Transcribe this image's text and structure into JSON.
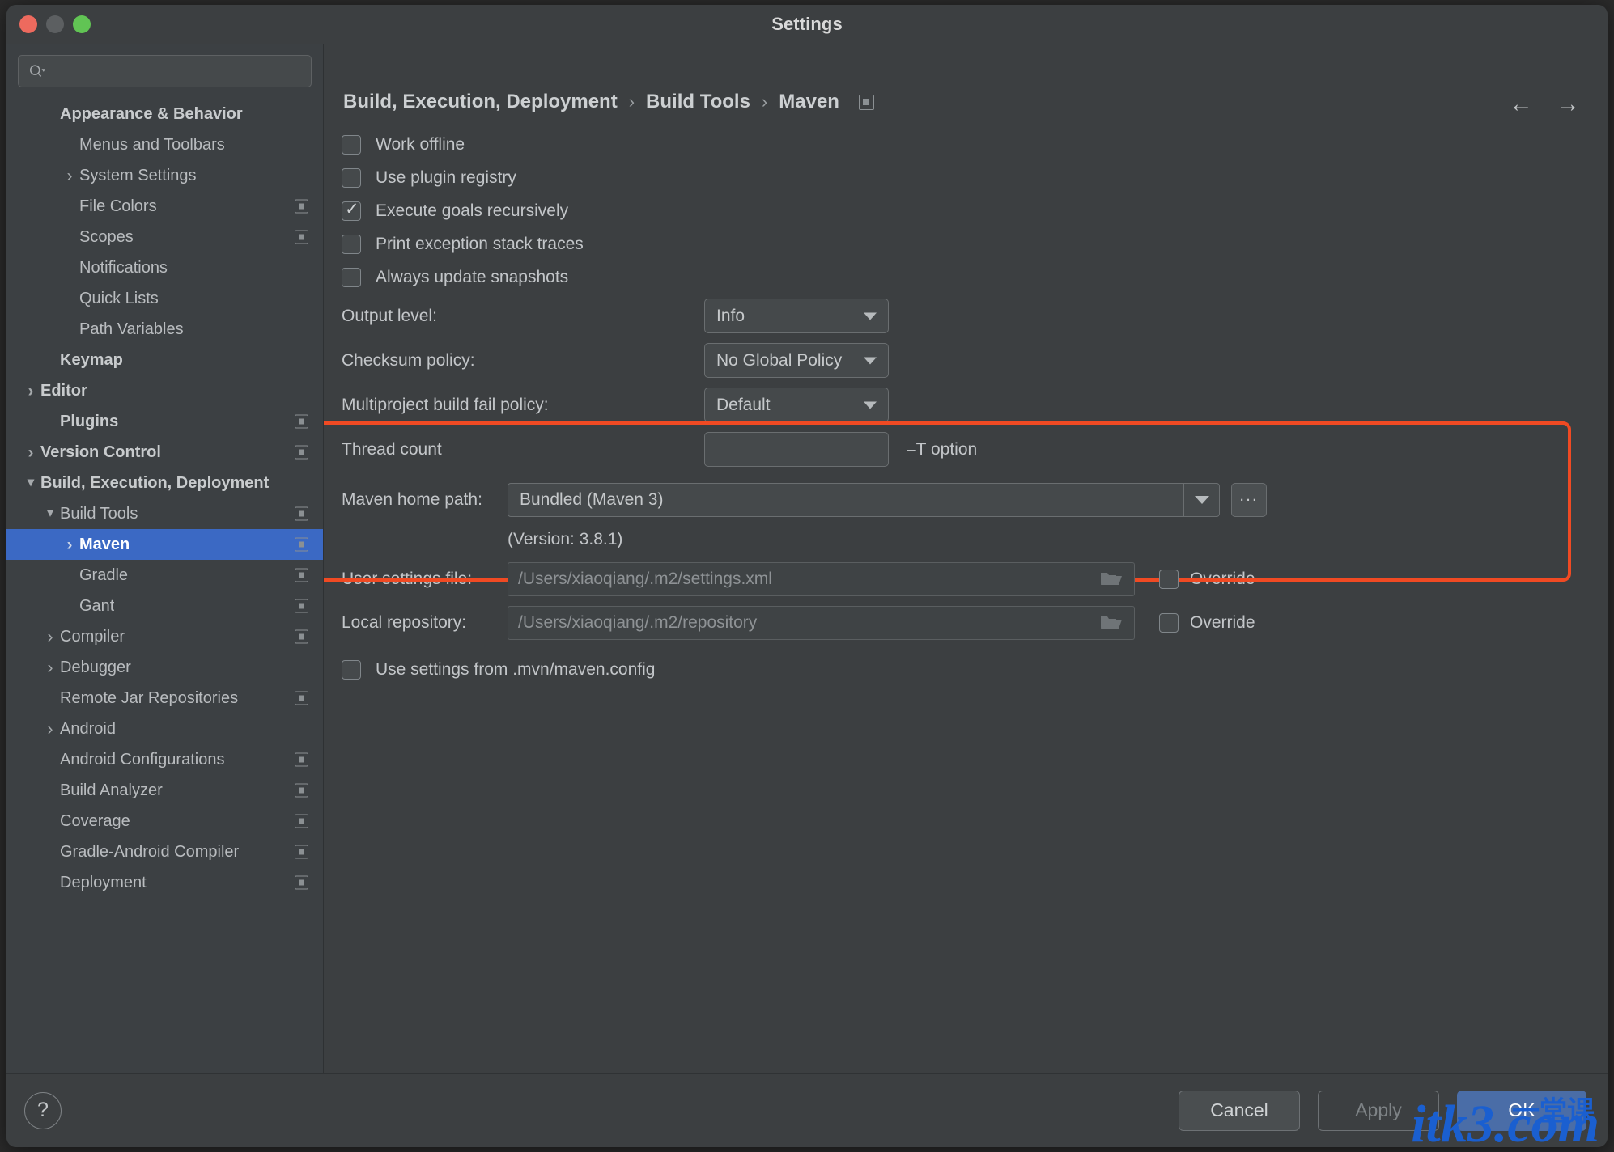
{
  "window": {
    "title": "Settings"
  },
  "search": {
    "placeholder": ""
  },
  "sidebar": {
    "items": [
      {
        "label": "Appearance & Behavior",
        "arrow": "none",
        "indent": 1,
        "bold": true,
        "badge": false,
        "selected": false
      },
      {
        "label": "Menus and Toolbars",
        "arrow": "none",
        "indent": 2,
        "bold": false,
        "badge": false,
        "selected": false
      },
      {
        "label": "System Settings",
        "arrow": "right",
        "indent": 2,
        "bold": false,
        "badge": false,
        "selected": false
      },
      {
        "label": "File Colors",
        "arrow": "none",
        "indent": 2,
        "bold": false,
        "badge": true,
        "selected": false
      },
      {
        "label": "Scopes",
        "arrow": "none",
        "indent": 2,
        "bold": false,
        "badge": true,
        "selected": false
      },
      {
        "label": "Notifications",
        "arrow": "none",
        "indent": 2,
        "bold": false,
        "badge": false,
        "selected": false
      },
      {
        "label": "Quick Lists",
        "arrow": "none",
        "indent": 2,
        "bold": false,
        "badge": false,
        "selected": false
      },
      {
        "label": "Path Variables",
        "arrow": "none",
        "indent": 2,
        "bold": false,
        "badge": false,
        "selected": false
      },
      {
        "label": "Keymap",
        "arrow": "none",
        "indent": 1,
        "bold": true,
        "badge": false,
        "selected": false
      },
      {
        "label": "Editor",
        "arrow": "right",
        "indent": 0,
        "bold": true,
        "badge": false,
        "selected": false
      },
      {
        "label": "Plugins",
        "arrow": "none",
        "indent": 1,
        "bold": true,
        "badge": true,
        "selected": false
      },
      {
        "label": "Version Control",
        "arrow": "right",
        "indent": 0,
        "bold": true,
        "badge": true,
        "selected": false
      },
      {
        "label": "Build, Execution, Deployment",
        "arrow": "down",
        "indent": 0,
        "bold": true,
        "badge": false,
        "selected": false
      },
      {
        "label": "Build Tools",
        "arrow": "down",
        "indent": 1,
        "bold": false,
        "badge": true,
        "selected": false
      },
      {
        "label": "Maven",
        "arrow": "right",
        "indent": 2,
        "bold": true,
        "badge": true,
        "selected": true
      },
      {
        "label": "Gradle",
        "arrow": "none",
        "indent": 2,
        "bold": false,
        "badge": true,
        "selected": false
      },
      {
        "label": "Gant",
        "arrow": "none",
        "indent": 2,
        "bold": false,
        "badge": true,
        "selected": false
      },
      {
        "label": "Compiler",
        "arrow": "right",
        "indent": 1,
        "bold": false,
        "badge": true,
        "selected": false
      },
      {
        "label": "Debugger",
        "arrow": "right",
        "indent": 1,
        "bold": false,
        "badge": false,
        "selected": false
      },
      {
        "label": "Remote Jar Repositories",
        "arrow": "none",
        "indent": 1,
        "bold": false,
        "badge": true,
        "selected": false
      },
      {
        "label": "Android",
        "arrow": "right",
        "indent": 1,
        "bold": false,
        "badge": false,
        "selected": false
      },
      {
        "label": "Android Configurations",
        "arrow": "none",
        "indent": 1,
        "bold": false,
        "badge": true,
        "selected": false
      },
      {
        "label": "Build Analyzer",
        "arrow": "none",
        "indent": 1,
        "bold": false,
        "badge": true,
        "selected": false
      },
      {
        "label": "Coverage",
        "arrow": "none",
        "indent": 1,
        "bold": false,
        "badge": true,
        "selected": false
      },
      {
        "label": "Gradle-Android Compiler",
        "arrow": "none",
        "indent": 1,
        "bold": false,
        "badge": true,
        "selected": false
      },
      {
        "label": "Deployment",
        "arrow": "none",
        "indent": 1,
        "bold": false,
        "badge": true,
        "selected": false
      }
    ]
  },
  "breadcrumb": {
    "part1": "Build, Execution, Deployment",
    "sep1": "›",
    "part2": "Build Tools",
    "sep2": "›",
    "part3": "Maven",
    "back_icon": "←",
    "forward_icon": "→"
  },
  "main": {
    "checkboxes": [
      {
        "label": "Work offline",
        "checked": false
      },
      {
        "label": "Use plugin registry",
        "checked": false
      },
      {
        "label": "Execute goals recursively",
        "checked": true
      },
      {
        "label": "Print exception stack traces",
        "checked": false
      },
      {
        "label": "Always update snapshots",
        "checked": false
      }
    ],
    "selects": [
      {
        "label": "Output level:",
        "value": "Info"
      },
      {
        "label": "Checksum policy:",
        "value": "No Global Policy"
      },
      {
        "label": "Multiproject build fail policy:",
        "value": "Default"
      }
    ],
    "thread_count": {
      "label": "Thread count",
      "value": "",
      "hint": "–T option"
    },
    "maven_home": {
      "label": "Maven home path:",
      "value": "Bundled (Maven 3)",
      "browse_label": "...",
      "version_text": "(Version: 3.8.1)"
    },
    "user_settings": {
      "label": "User settings file:",
      "value": "/Users/xiaoqiang/.m2/settings.xml",
      "override_label": "Override",
      "override_checked": false
    },
    "local_repository": {
      "label": "Local repository:",
      "value": "/Users/xiaoqiang/.m2/repository",
      "override_label": "Override",
      "override_checked": false
    },
    "mvn_config": {
      "label": "Use settings from .mvn/maven.config",
      "checked": false
    }
  },
  "footer": {
    "help_label": "?",
    "cancel_label": "Cancel",
    "apply_label": "Apply",
    "ok_label": "OK"
  },
  "watermark": {
    "text": "itk3.com",
    "cjk": "一堂课"
  },
  "colors": {
    "accent_blue": "#3b69c4",
    "ok_button": "#4a6da7",
    "highlight_red": "#f04a23",
    "window_bg": "#3c3f41",
    "sidebar_bg": "#3c4043"
  }
}
